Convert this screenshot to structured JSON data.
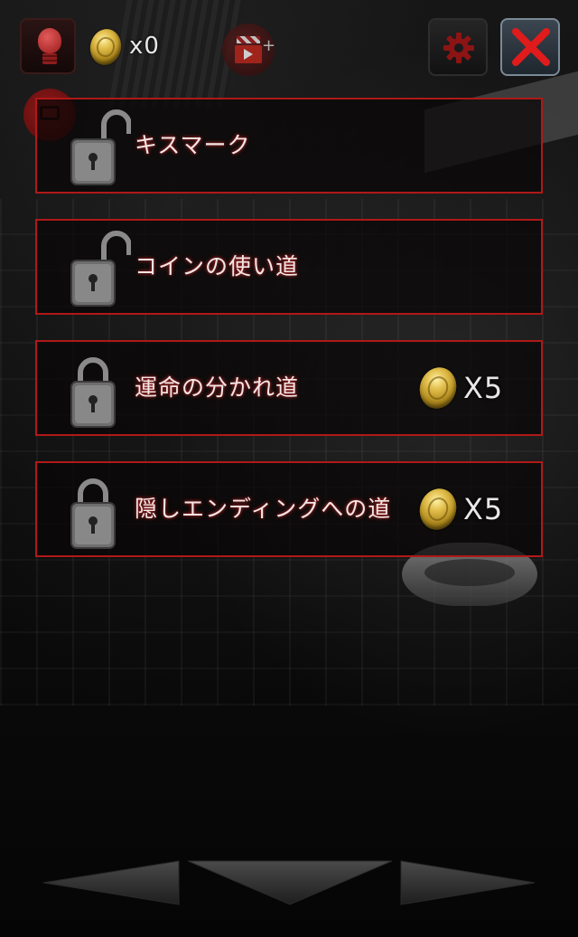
{
  "header": {
    "hint_icon": "lightbulb-icon",
    "coin_icon": "coin-icon",
    "coin_count": "x0",
    "video_icon": "video-reward-icon",
    "settings_icon": "gear-icon",
    "close_icon": "close-icon"
  },
  "items": [
    {
      "label": "キスマーク",
      "locked": false,
      "price": ""
    },
    {
      "label": "コインの使い道",
      "locked": false,
      "price": ""
    },
    {
      "label": "運命の分かれ道",
      "locked": true,
      "price": "X5"
    },
    {
      "label": "隠しエンディングへの道",
      "locked": true,
      "price": "X5"
    }
  ],
  "nav": {
    "left_icon": "arrow-left-icon",
    "down_icon": "arrow-down-icon",
    "right_icon": "arrow-right-icon"
  },
  "colors": {
    "item_border": "#b01818",
    "close_bg": "#2e3944",
    "close_x": "#e01b1b"
  }
}
